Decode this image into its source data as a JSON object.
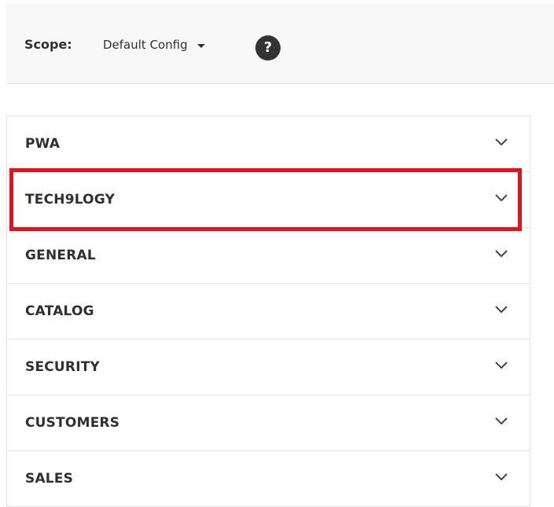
{
  "scope": {
    "label": "Scope:",
    "value": "Default Config",
    "help_icon": "question-circle-icon"
  },
  "config_sections": [
    {
      "label": "PWA",
      "icon": "chevron-down-icon"
    },
    {
      "label": "TECH9LOGY",
      "icon": "chevron-down-icon",
      "highlighted": true
    },
    {
      "label": "GENERAL",
      "icon": "chevron-down-icon"
    },
    {
      "label": "CATALOG",
      "icon": "chevron-down-icon"
    },
    {
      "label": "SECURITY",
      "icon": "chevron-down-icon"
    },
    {
      "label": "CUSTOMERS",
      "icon": "chevron-down-icon"
    },
    {
      "label": "SALES",
      "icon": "chevron-down-icon"
    }
  ],
  "colors": {
    "highlight": "#e8101c",
    "text": "#303030",
    "help_icon_bg": "#333333"
  }
}
